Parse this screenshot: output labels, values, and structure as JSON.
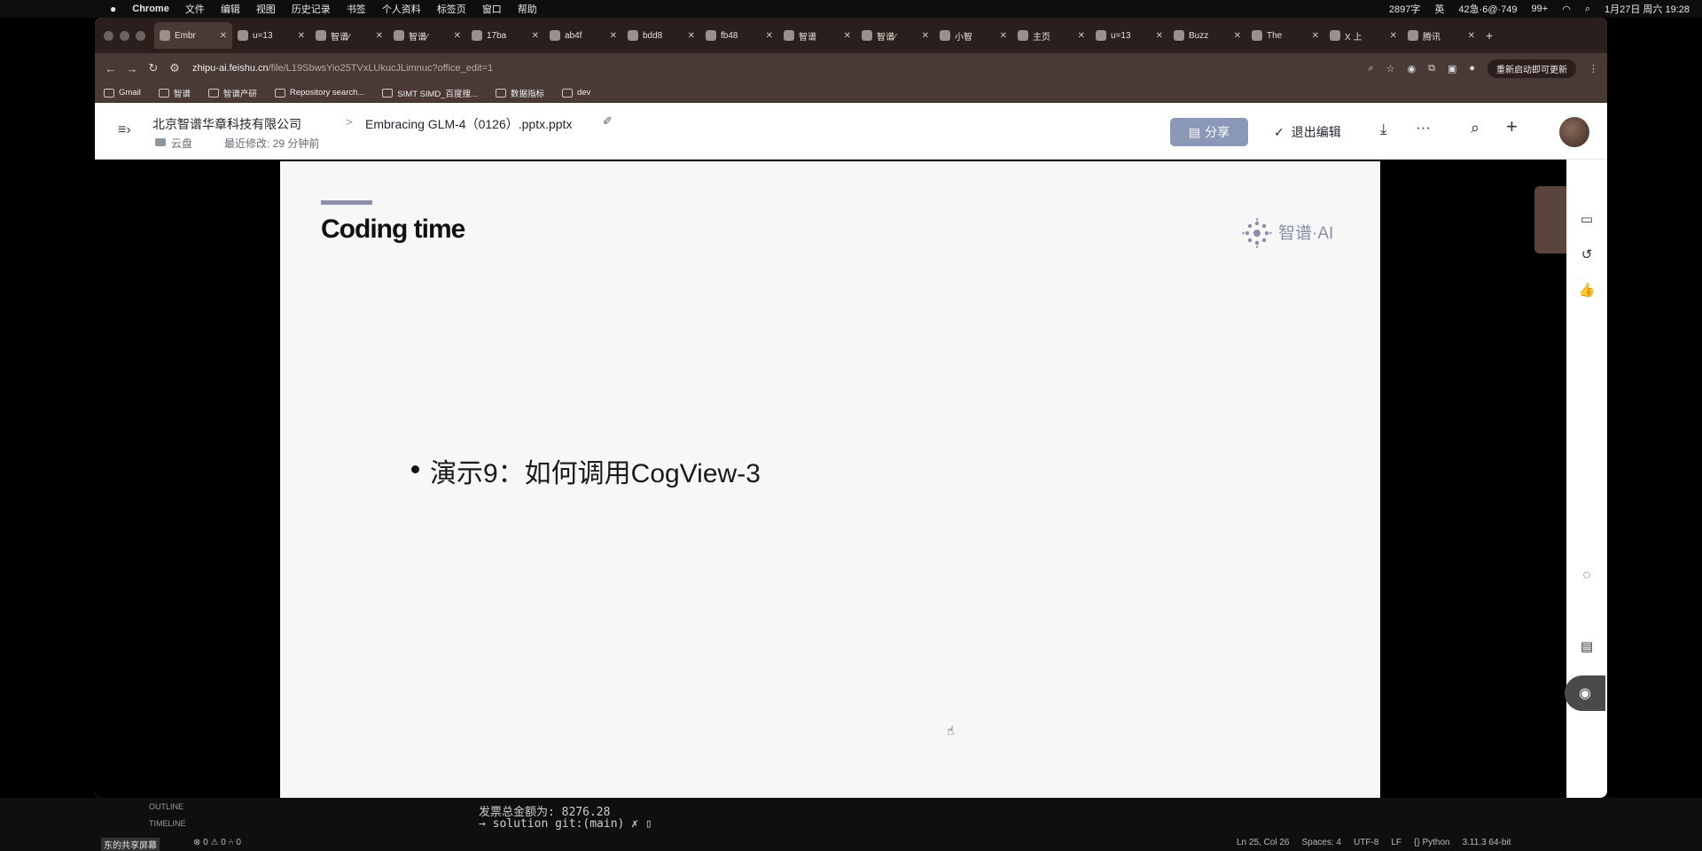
{
  "menubar": {
    "apple": "",
    "items": [
      "Chrome",
      "文件",
      "编辑",
      "视图",
      "历史记录",
      "书签",
      "个人资料",
      "标签页",
      "窗口",
      "帮助"
    ],
    "right": [
      "2897字",
      "英",
      "42急·6@·749",
      "99+",
      "1月27日 周六 19:28"
    ]
  },
  "tabs": [
    {
      "label": "Embr",
      "active": true
    },
    {
      "label": "u=13",
      "active": false
    },
    {
      "label": "智谱⁄",
      "active": false
    },
    {
      "label": "智谱⁄",
      "active": false
    },
    {
      "label": "17ba",
      "active": false
    },
    {
      "label": "ab4f",
      "active": false
    },
    {
      "label": "bdd8",
      "active": false
    },
    {
      "label": "fb48",
      "active": false
    },
    {
      "label": "智谱",
      "active": false
    },
    {
      "label": "智谱⁄",
      "active": false
    },
    {
      "label": "小智",
      "active": false
    },
    {
      "label": "主页",
      "active": false
    },
    {
      "label": "u=13",
      "active": false
    },
    {
      "label": "Buzz",
      "active": false
    },
    {
      "label": "The",
      "active": false
    },
    {
      "label": "X 上",
      "active": false
    },
    {
      "label": "腾讯",
      "active": false
    }
  ],
  "address": {
    "host": "zhipu-ai.feishu.cn",
    "path": "/file/L19SbwsYio25TVxLUkucJLimnuc?office_edit=1",
    "restart_label": "重新启动即可更新"
  },
  "bookmarks": [
    "Gmail",
    "智谱",
    "智谱产研",
    "Repository search...",
    "SIMT SIMD_百度搜...",
    "数据指标",
    "dev"
  ],
  "header": {
    "org": "北京智谱华章科技有限公司",
    "separator": ">",
    "title": "Embracing GLM-4（0126）.pptx.pptx",
    "folder": "云盘",
    "last_modified": "最近修改: 29 分钟前",
    "share": "分享",
    "exit_edit": "退出编辑"
  },
  "slide": {
    "title": "Coding time",
    "logo_text": "智谱·AI",
    "bullet": "演示9：如何调用CogView-3"
  },
  "vscode": {
    "outline": "OUTLINE",
    "timeline": "TIMELINE",
    "term1": "发票总金额为:  8276.28",
    "term2": "→  solution git:(main) ✗ ▯",
    "status_left": "东的共享屏幕",
    "status_errors": "⊗ 0 ⚠ 0   ⑃ 0",
    "status_right": [
      "Ln 25, Col 26",
      "Spaces: 4",
      "UTF-8",
      "LF",
      "{} Python",
      "3.11.3 64-bit"
    ]
  },
  "colors": {
    "accent": "#8b98b8",
    "tabbar": "#2b1f1d",
    "toolbar": "#4a3a36"
  }
}
